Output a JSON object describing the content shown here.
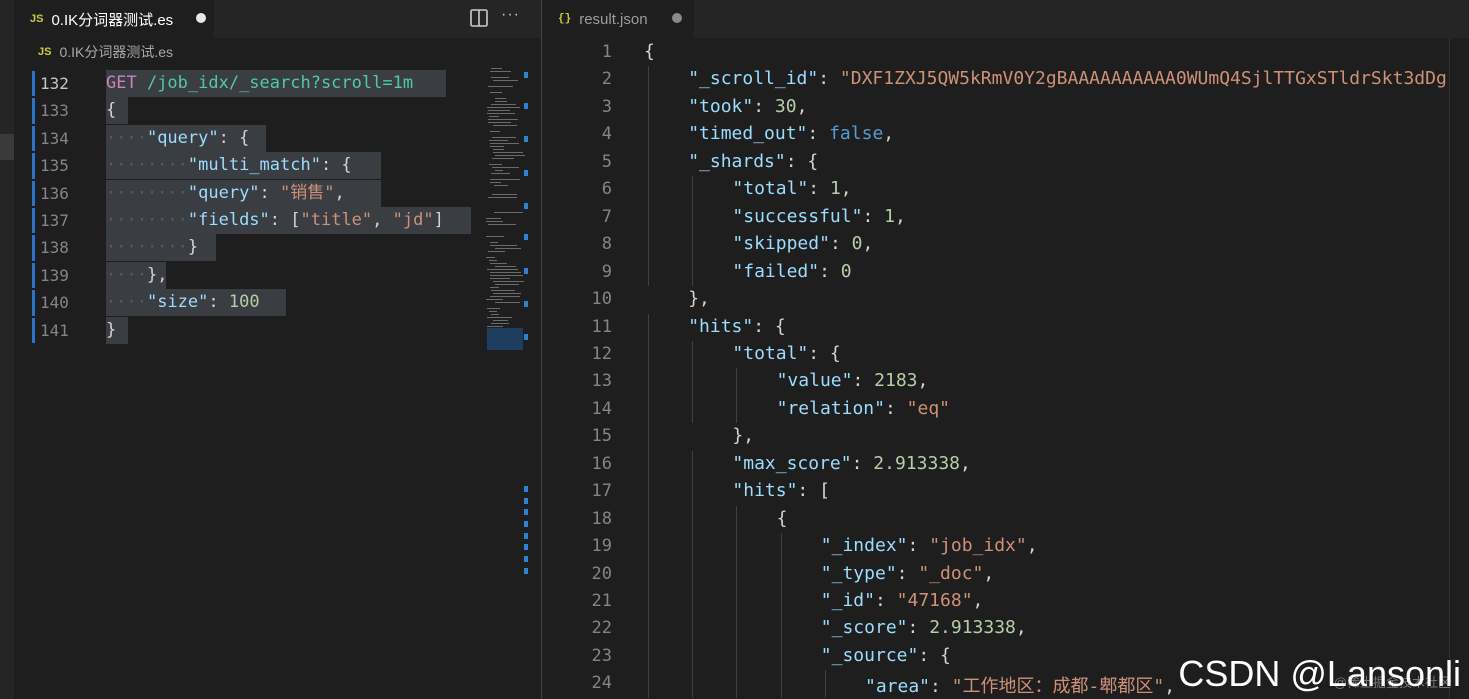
{
  "left_editor": {
    "tab": {
      "language_badge": "JS",
      "title": "0.IK分词器测试.es"
    },
    "breadcrumb": {
      "language_badge": "JS",
      "file": "0.IK分词器测试.es"
    },
    "lines": [
      {
        "num": "132",
        "segs": [
          {
            "t": "GET",
            "c": "m"
          },
          {
            "t": " /job_idx/_search?scroll=1m",
            "c": "u"
          }
        ]
      },
      {
        "num": "133",
        "segs": [
          {
            "t": "{",
            "c": "p"
          }
        ]
      },
      {
        "num": "134",
        "segs": [
          {
            "t": "····",
            "c": "dots"
          },
          {
            "t": "\"query\"",
            "c": "k"
          },
          {
            "t": ": {",
            "c": "p"
          }
        ]
      },
      {
        "num": "135",
        "segs": [
          {
            "t": "········",
            "c": "dots"
          },
          {
            "t": "\"multi_match\"",
            "c": "k"
          },
          {
            "t": ": {",
            "c": "p"
          }
        ]
      },
      {
        "num": "136",
        "segs": [
          {
            "t": "········",
            "c": "dots"
          },
          {
            "t": "\"query\"",
            "c": "k"
          },
          {
            "t": ": ",
            "c": "p"
          },
          {
            "t": "\"销售\"",
            "c": "s"
          },
          {
            "t": ",",
            "c": "p"
          }
        ]
      },
      {
        "num": "137",
        "segs": [
          {
            "t": "········",
            "c": "dots"
          },
          {
            "t": "\"fields\"",
            "c": "k"
          },
          {
            "t": ": [",
            "c": "p"
          },
          {
            "t": "\"title\"",
            "c": "s"
          },
          {
            "t": ", ",
            "c": "p"
          },
          {
            "t": "\"jd\"",
            "c": "s"
          },
          {
            "t": "]",
            "c": "p"
          }
        ]
      },
      {
        "num": "138",
        "segs": [
          {
            "t": "········",
            "c": "dots"
          },
          {
            "t": "}",
            "c": "p"
          }
        ]
      },
      {
        "num": "139",
        "segs": [
          {
            "t": "····",
            "c": "dots"
          },
          {
            "t": "},",
            "c": "p"
          }
        ]
      },
      {
        "num": "140",
        "segs": [
          {
            "t": "····",
            "c": "dots"
          },
          {
            "t": "\"size\"",
            "c": "k"
          },
          {
            "t": ": ",
            "c": "p"
          },
          {
            "t": "100",
            "c": "n"
          }
        ]
      },
      {
        "num": "141",
        "segs": [
          {
            "t": "}",
            "c": "p"
          }
        ]
      }
    ]
  },
  "right_editor": {
    "tab": {
      "language_badge": "{}",
      "title": "result.json"
    },
    "lines": [
      {
        "num": "1",
        "ind": 0,
        "segs": [
          {
            "t": "{",
            "c": "p"
          }
        ]
      },
      {
        "num": "2",
        "ind": 1,
        "segs": [
          {
            "t": "\"_scroll_id\"",
            "c": "k"
          },
          {
            "t": ": ",
            "c": "p"
          },
          {
            "t": "\"DXF1ZXJ5QW5kRmV0Y2gBAAAAAAAAAA0WUmQ4SjlTTGxSTldrSkt3dDg",
            "c": "s"
          }
        ]
      },
      {
        "num": "3",
        "ind": 1,
        "segs": [
          {
            "t": "\"took\"",
            "c": "k"
          },
          {
            "t": ": ",
            "c": "p"
          },
          {
            "t": "30",
            "c": "n"
          },
          {
            "t": ",",
            "c": "p"
          }
        ]
      },
      {
        "num": "4",
        "ind": 1,
        "segs": [
          {
            "t": "\"timed_out\"",
            "c": "k"
          },
          {
            "t": ": ",
            "c": "p"
          },
          {
            "t": "false",
            "c": "b"
          },
          {
            "t": ",",
            "c": "p"
          }
        ]
      },
      {
        "num": "5",
        "ind": 1,
        "segs": [
          {
            "t": "\"_shards\"",
            "c": "k"
          },
          {
            "t": ": {",
            "c": "p"
          }
        ]
      },
      {
        "num": "6",
        "ind": 2,
        "segs": [
          {
            "t": "\"total\"",
            "c": "k"
          },
          {
            "t": ": ",
            "c": "p"
          },
          {
            "t": "1",
            "c": "n"
          },
          {
            "t": ",",
            "c": "p"
          }
        ]
      },
      {
        "num": "7",
        "ind": 2,
        "segs": [
          {
            "t": "\"successful\"",
            "c": "k"
          },
          {
            "t": ": ",
            "c": "p"
          },
          {
            "t": "1",
            "c": "n"
          },
          {
            "t": ",",
            "c": "p"
          }
        ]
      },
      {
        "num": "8",
        "ind": 2,
        "segs": [
          {
            "t": "\"skipped\"",
            "c": "k"
          },
          {
            "t": ": ",
            "c": "p"
          },
          {
            "t": "0",
            "c": "n"
          },
          {
            "t": ",",
            "c": "p"
          }
        ]
      },
      {
        "num": "9",
        "ind": 2,
        "segs": [
          {
            "t": "\"failed\"",
            "c": "k"
          },
          {
            "t": ": ",
            "c": "p"
          },
          {
            "t": "0",
            "c": "n"
          }
        ]
      },
      {
        "num": "10",
        "ind": 1,
        "segs": [
          {
            "t": "},",
            "c": "p"
          }
        ]
      },
      {
        "num": "11",
        "ind": 1,
        "segs": [
          {
            "t": "\"hits\"",
            "c": "k"
          },
          {
            "t": ": {",
            "c": "p"
          }
        ]
      },
      {
        "num": "12",
        "ind": 2,
        "segs": [
          {
            "t": "\"total\"",
            "c": "k"
          },
          {
            "t": ": {",
            "c": "p"
          }
        ]
      },
      {
        "num": "13",
        "ind": 3,
        "segs": [
          {
            "t": "\"value\"",
            "c": "k"
          },
          {
            "t": ": ",
            "c": "p"
          },
          {
            "t": "2183",
            "c": "n"
          },
          {
            "t": ",",
            "c": "p"
          }
        ]
      },
      {
        "num": "14",
        "ind": 3,
        "segs": [
          {
            "t": "\"relation\"",
            "c": "k"
          },
          {
            "t": ": ",
            "c": "p"
          },
          {
            "t": "\"eq\"",
            "c": "s"
          }
        ]
      },
      {
        "num": "15",
        "ind": 2,
        "segs": [
          {
            "t": "},",
            "c": "p"
          }
        ]
      },
      {
        "num": "16",
        "ind": 2,
        "segs": [
          {
            "t": "\"max_score\"",
            "c": "k"
          },
          {
            "t": ": ",
            "c": "p"
          },
          {
            "t": "2.913338",
            "c": "n"
          },
          {
            "t": ",",
            "c": "p"
          }
        ]
      },
      {
        "num": "17",
        "ind": 2,
        "segs": [
          {
            "t": "\"hits\"",
            "c": "k"
          },
          {
            "t": ": [",
            "c": "p"
          }
        ]
      },
      {
        "num": "18",
        "ind": 3,
        "segs": [
          {
            "t": "{",
            "c": "p"
          }
        ]
      },
      {
        "num": "19",
        "ind": 4,
        "segs": [
          {
            "t": "\"_index\"",
            "c": "k"
          },
          {
            "t": ": ",
            "c": "p"
          },
          {
            "t": "\"job_idx\"",
            "c": "s"
          },
          {
            "t": ",",
            "c": "p"
          }
        ]
      },
      {
        "num": "20",
        "ind": 4,
        "segs": [
          {
            "t": "\"_type\"",
            "c": "k"
          },
          {
            "t": ": ",
            "c": "p"
          },
          {
            "t": "\"_doc\"",
            "c": "s"
          },
          {
            "t": ",",
            "c": "p"
          }
        ]
      },
      {
        "num": "21",
        "ind": 4,
        "segs": [
          {
            "t": "\"_id\"",
            "c": "k"
          },
          {
            "t": ": ",
            "c": "p"
          },
          {
            "t": "\"47168\"",
            "c": "s"
          },
          {
            "t": ",",
            "c": "p"
          }
        ]
      },
      {
        "num": "22",
        "ind": 4,
        "segs": [
          {
            "t": "\"_score\"",
            "c": "k"
          },
          {
            "t": ": ",
            "c": "p"
          },
          {
            "t": "2.913338",
            "c": "n"
          },
          {
            "t": ",",
            "c": "p"
          }
        ]
      },
      {
        "num": "23",
        "ind": 4,
        "segs": [
          {
            "t": "\"_source\"",
            "c": "k"
          },
          {
            "t": ": {",
            "c": "p"
          }
        ]
      },
      {
        "num": "24",
        "ind": 5,
        "segs": [
          {
            "t": "\"area\"",
            "c": "k"
          },
          {
            "t": ": ",
            "c": "p"
          },
          {
            "t": "\"工作地区：成都-郫都区\"",
            "c": "s"
          },
          {
            "t": ",",
            "c": "p"
          }
        ]
      }
    ]
  },
  "watermark": {
    "text": "CSDN @Lansonli",
    "sub": "@稀土掘金技术社区"
  },
  "colors": {
    "key": "#9cdcfe",
    "string": "#ce9178",
    "number": "#b5cea8",
    "boolean": "#569cd6",
    "method": "#c586c0",
    "url": "#4ec9b0",
    "gutter_bar": "#2a73c8"
  }
}
